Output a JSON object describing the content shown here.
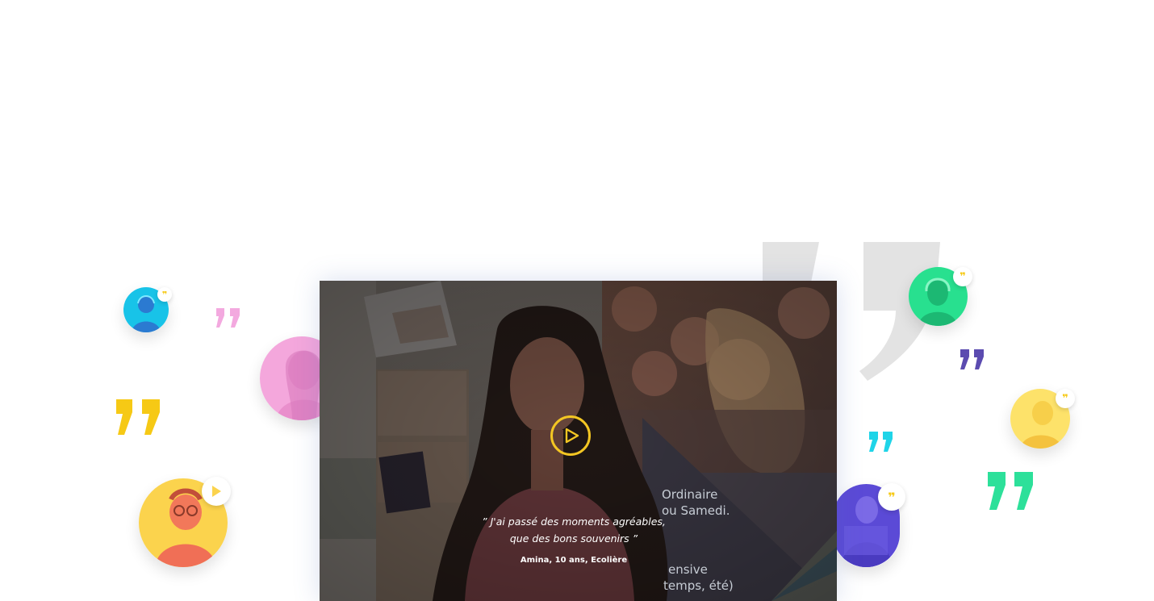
{
  "testimonial": {
    "quote": "” J'ai passé des moments agréables, que des bons souvenirs ”",
    "quote_line1": "” J'ai passé des moments agréables,",
    "quote_line2": "que des bons souvenirs ”",
    "author": "Amina, 10 ans, Ecolière"
  },
  "poster": {
    "line1": "Ordinaire",
    "line2": "ou Samedi.",
    "line3": "ensive",
    "line4": "temps, été)"
  },
  "icons": {
    "play": "play-icon",
    "quote": "quote-icon",
    "avatar_badge_play": "play-icon",
    "avatar_badge_quote": "quote-icon"
  },
  "colors": {
    "accent_yellow": "#f3c623",
    "quote_yellow": "#f6c915",
    "quote_pink": "#f3a9df",
    "quote_cyan": "#1fd4e8",
    "quote_purple": "#5b4bb0",
    "quote_green": "#2de09a",
    "big_quote_gray": "#e3e3e3"
  }
}
